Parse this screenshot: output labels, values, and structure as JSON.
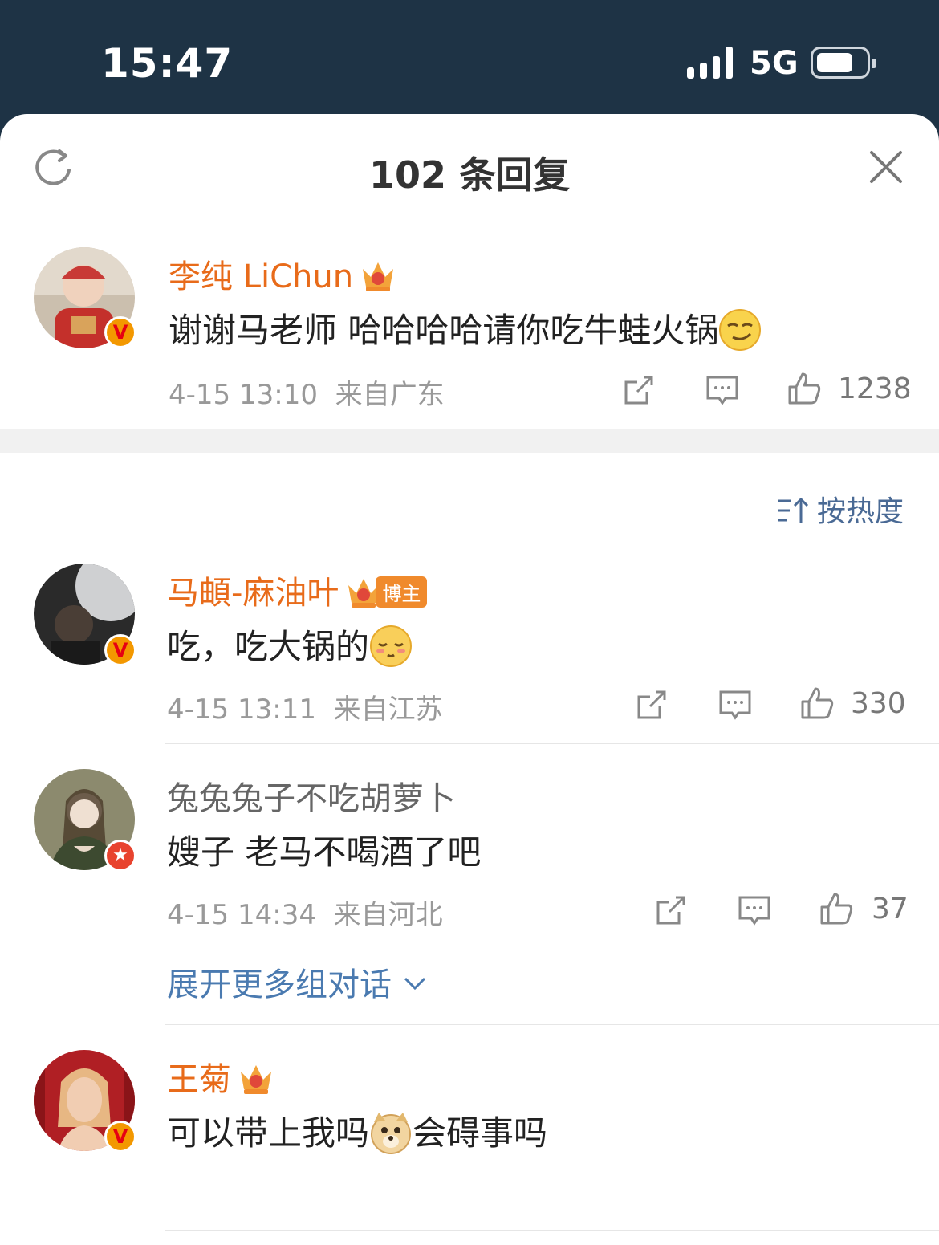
{
  "status_bar": {
    "time": "15:47",
    "network": "5G"
  },
  "header": {
    "title": "102 条回复"
  },
  "sort": {
    "label": "按热度"
  },
  "comments": [
    {
      "username": "李纯 LiChun",
      "text": "谢谢马老师  哈哈哈哈请你吃牛蛙火锅",
      "date": "4-15 13:10",
      "location": "来自广东",
      "likes": "1238",
      "badge": "v",
      "emoji": "smirk"
    },
    {
      "username": "马頔-麻油叶",
      "tag": "博主",
      "text": "吃，吃大锅的",
      "date": "4-15 13:11",
      "location": "来自江苏",
      "likes": "330",
      "badge": "v",
      "emoji": "shy"
    },
    {
      "username": "兔兔兔子不吃胡萝卜",
      "text": "嫂子 老马不喝酒了吧",
      "date": "4-15 14:34",
      "location": "来自河北",
      "likes": "37",
      "badge": "star"
    },
    {
      "username": "王菊",
      "text_before": "可以带上我吗",
      "text_after": "会碍事吗",
      "badge": "v",
      "emoji": "doge"
    }
  ],
  "expand": {
    "label": "展开更多组对话"
  },
  "colors": {
    "username": "#e86b1a",
    "link": "#4a7ab0",
    "status_bg": "#1e3345"
  }
}
